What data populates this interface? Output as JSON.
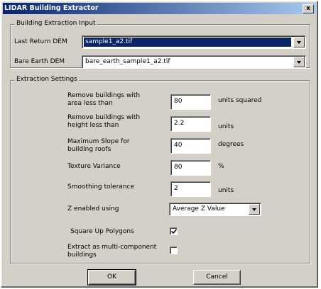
{
  "window": {
    "title": "LIDAR Building Extractor",
    "close_label": "x"
  },
  "input_group": {
    "label": "Building Extraction Input",
    "last_return": {
      "label": "Last Return DEM",
      "value": "sample1_a2.tif"
    },
    "bare_earth": {
      "label": "Bare Earth DEM",
      "value": "bare_earth_sample1_a2.tif"
    }
  },
  "settings_group": {
    "label": "Extraction Settings",
    "remove_area": {
      "label": "Remove buildings with area less than",
      "value": "80",
      "unit": "units squared"
    },
    "remove_height": {
      "label": "Remove buildings with height less than",
      "value": "2.2",
      "unit": "units"
    },
    "max_slope": {
      "label": "Maximum Slope for building roofs",
      "value": "40",
      "unit": "degrees"
    },
    "texture_variance": {
      "label": "Texture Variance",
      "value": "80",
      "unit": "%"
    },
    "smoothing": {
      "label": "Smoothing tolerance",
      "value": "2",
      "unit": "units"
    },
    "z_enabled": {
      "label": "Z enabled using",
      "value": "Average Z Value"
    },
    "square_up": {
      "label": "Square Up Polygons",
      "checked": true
    },
    "multi_component": {
      "label": "Extract as multi-component buildings",
      "checked": false
    }
  },
  "buttons": {
    "ok": "OK",
    "cancel": "Cancel"
  },
  "colors": {
    "face": "#d4d0c8",
    "title_start": "#0a246a",
    "title_end": "#a6caf0",
    "selection": "#0a246a"
  }
}
